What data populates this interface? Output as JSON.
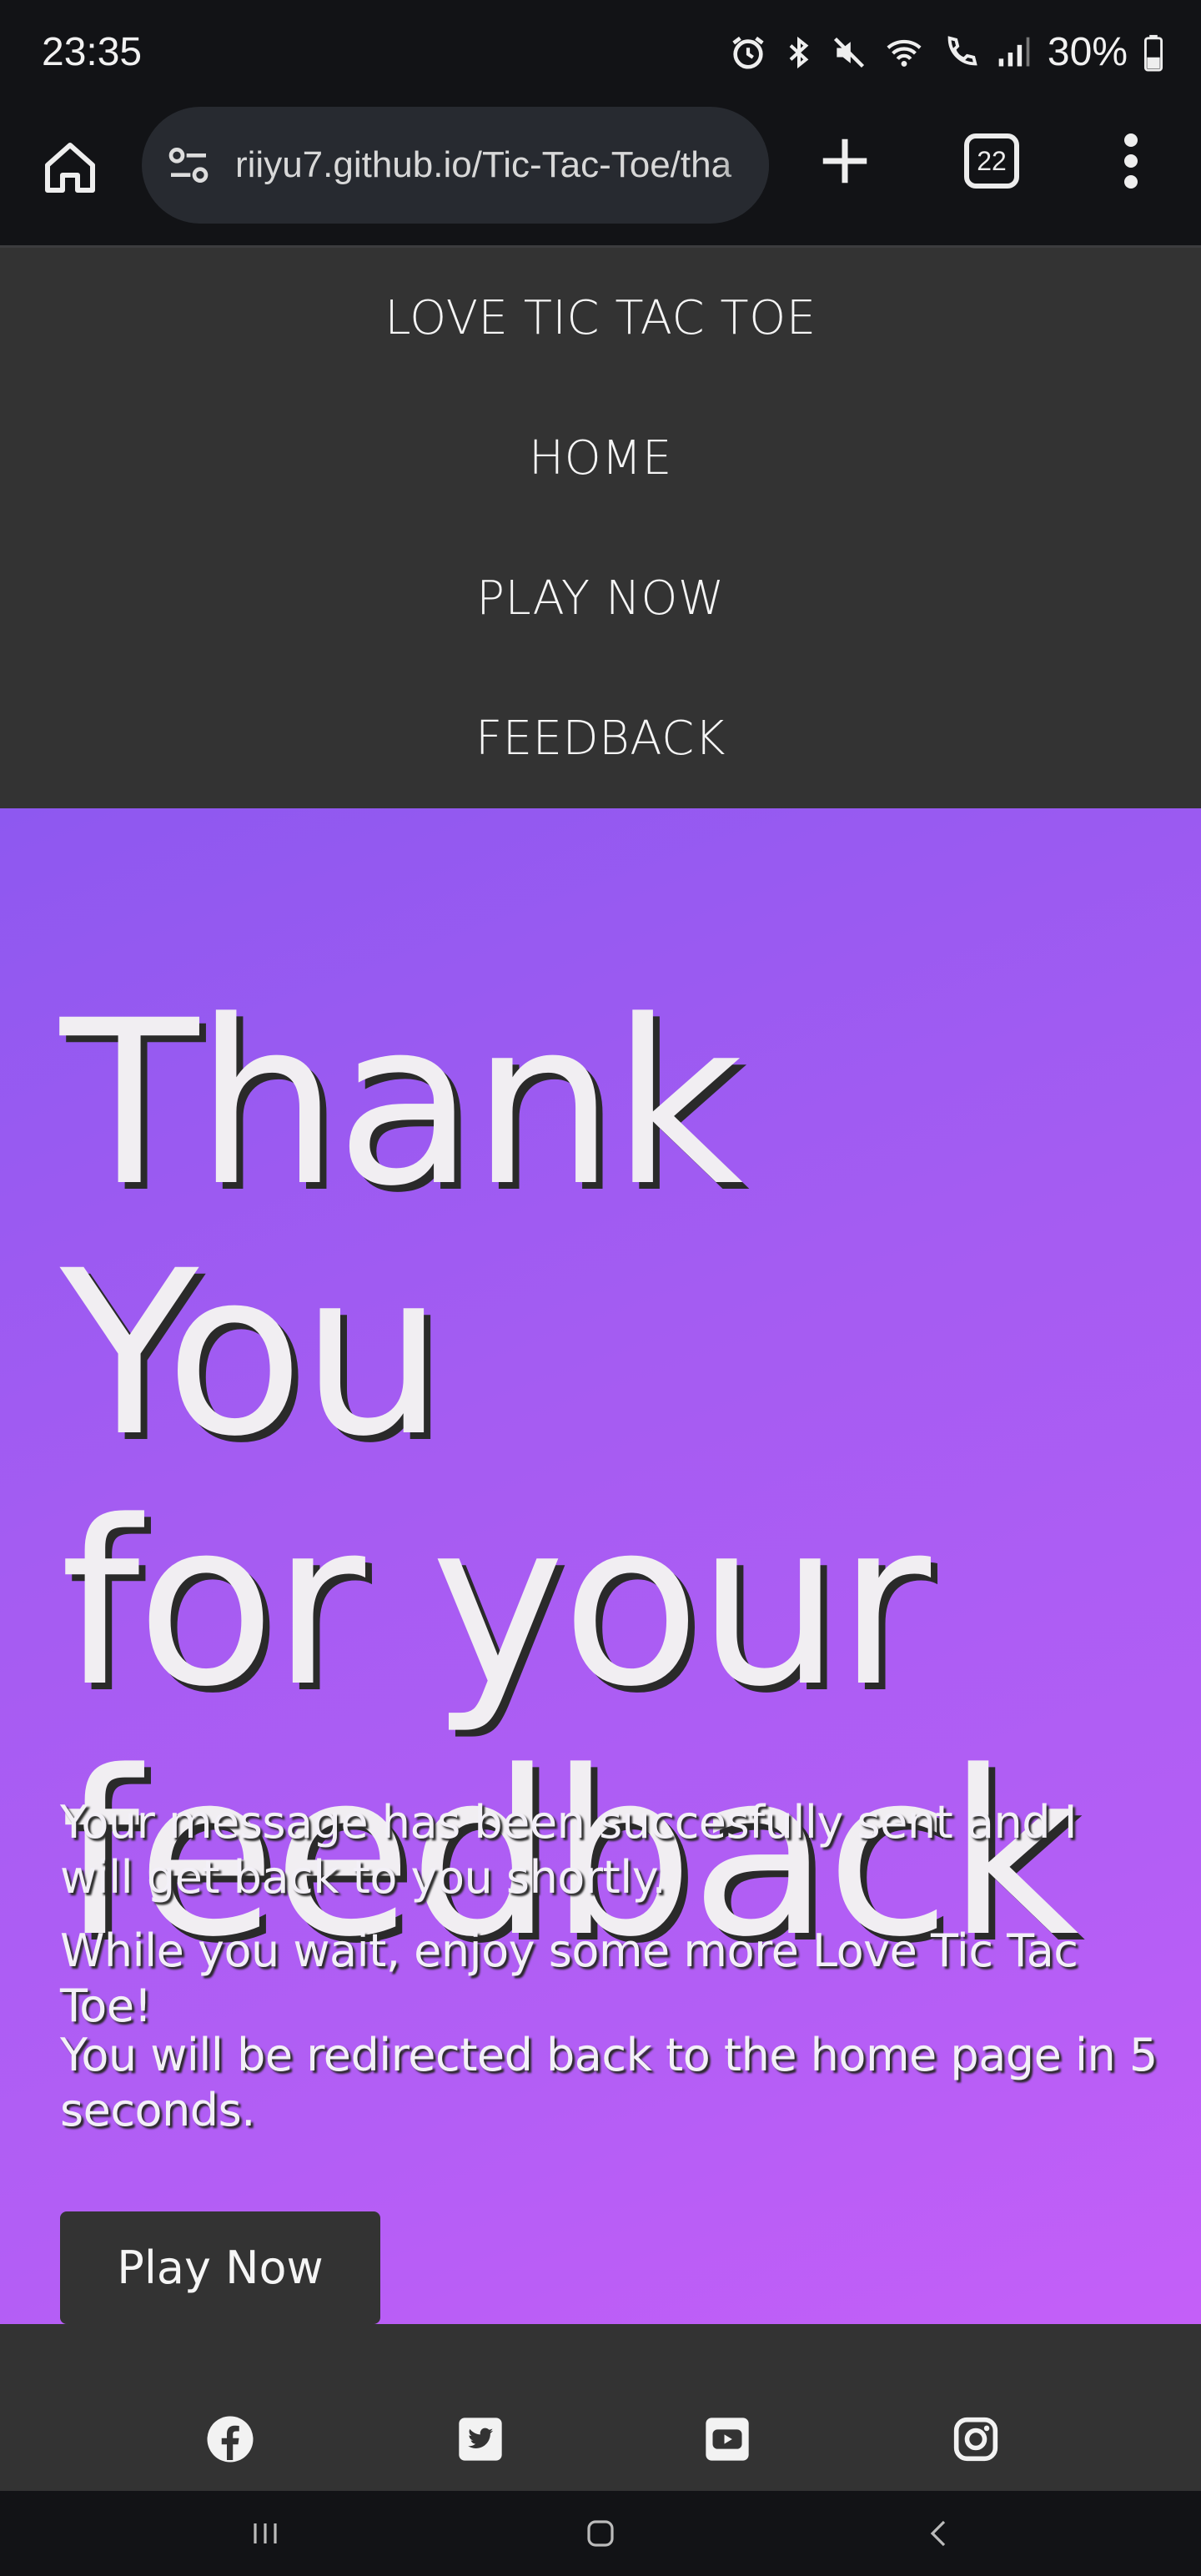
{
  "status_bar": {
    "time": "23:35",
    "battery": "30%",
    "icons": [
      "alarm-icon",
      "bluetooth-icon",
      "mute-icon",
      "wifi-icon",
      "wifi-calling-icon",
      "signal-icon",
      "battery-icon"
    ]
  },
  "browser": {
    "url": "riiyu7.github.io/Tic-Tac-Toe/tha",
    "tab_count": "22"
  },
  "nav": {
    "brand": "LOVE TIC TAC TOE",
    "items": [
      "HOME",
      "PLAY NOW",
      "FEEDBACK"
    ]
  },
  "hero": {
    "title_line1": "Thank You",
    "title_line2": "for your",
    "title_line3": "feedback",
    "paragraph1": "Your message has been succesfully sent and I will get back to you shortly.",
    "paragraph2": "While you wait, enjoy some more Love Tic Tac Toe!",
    "paragraph3": "You will be redirected back to the home page in 5 seconds.",
    "button": "Play Now",
    "gradient_start": "#8e58f0",
    "gradient_end": "#c45ff8"
  },
  "footer": {
    "social": [
      "facebook-icon",
      "twitter-icon",
      "youtube-icon",
      "instagram-icon"
    ]
  },
  "colors": {
    "nav_bg": "#333333",
    "system_bg": "#121316",
    "text": "#f5f5f5"
  }
}
